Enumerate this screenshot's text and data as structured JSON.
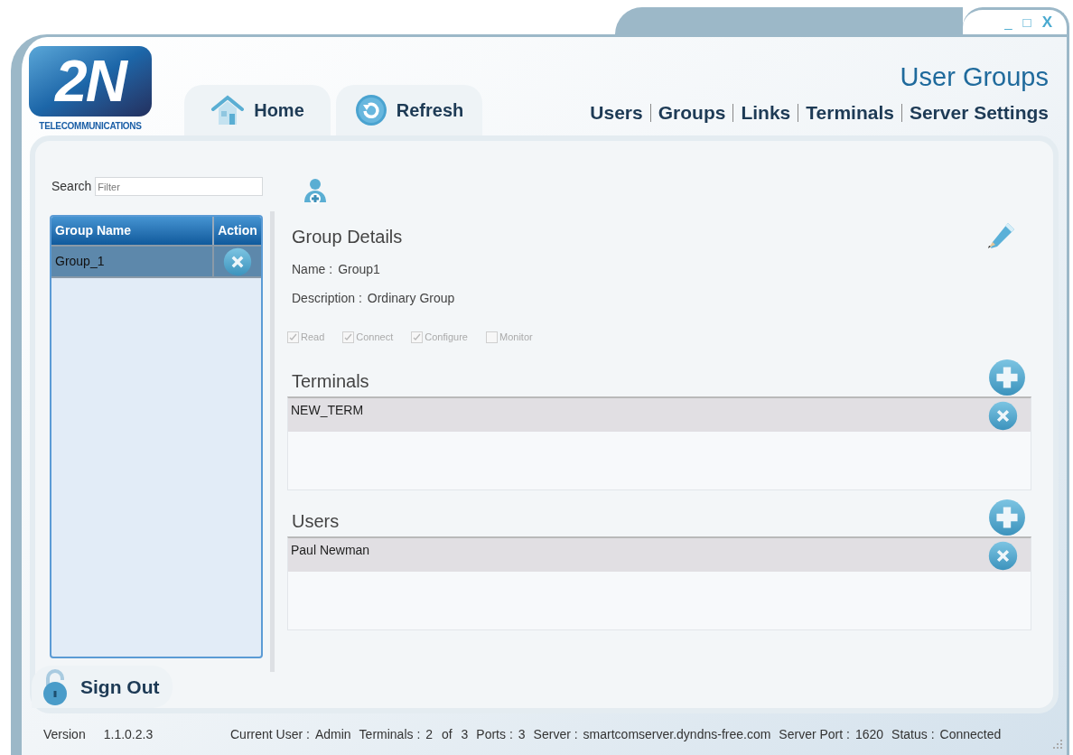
{
  "window": {
    "controls": [
      "_",
      "□",
      "X"
    ]
  },
  "logo": {
    "mark": "2N",
    "tagline": "TELECOMMUNICATIONS"
  },
  "toolbar_tabs": [
    {
      "kind": "home",
      "label": "Home"
    },
    {
      "kind": "refresh",
      "label": "Refresh"
    }
  ],
  "page_title": "User Groups",
  "nav_links": [
    "Users",
    "Groups",
    "Links",
    "Terminals",
    "Server Settings"
  ],
  "search": {
    "label": "Search",
    "placeholder": "Filter"
  },
  "groups_table": {
    "columns": [
      "Group Name",
      "Action"
    ],
    "rows": [
      {
        "name": "Group_1",
        "selected": true
      }
    ]
  },
  "details": {
    "heading": "Group Details",
    "fields": [
      {
        "label": "Name :",
        "value": "Group1"
      },
      {
        "label": "Description :",
        "value": "Ordinary Group"
      }
    ],
    "permissions": [
      {
        "label": "Read",
        "checked": true,
        "disabled": true
      },
      {
        "label": "Connect",
        "checked": true,
        "disabled": true
      },
      {
        "label": "Configure",
        "checked": true,
        "disabled": true
      },
      {
        "label": "Monitor",
        "checked": false,
        "disabled": true
      }
    ]
  },
  "terminals": {
    "heading": "Terminals",
    "items": [
      {
        "name": "NEW_TERM",
        "selected": true
      }
    ]
  },
  "users": {
    "heading": "Users",
    "items": [
      {
        "name": "Paul Newman",
        "selected": true
      }
    ]
  },
  "sign_out": "Sign Out",
  "status_bar": {
    "version_label": "Version",
    "version": "1.1.0.2.3",
    "fields": [
      {
        "label": "Current User :",
        "value": "Admin"
      },
      {
        "label": "Terminals :",
        "value": "2 of 3"
      },
      {
        "label": "Ports :",
        "value": "3"
      },
      {
        "label": "Server :",
        "value": "smartcomserver.dyndns-free.com"
      },
      {
        "label": "Server Port :",
        "value": "1620"
      },
      {
        "label": "Status :",
        "value": "Connected"
      }
    ]
  }
}
